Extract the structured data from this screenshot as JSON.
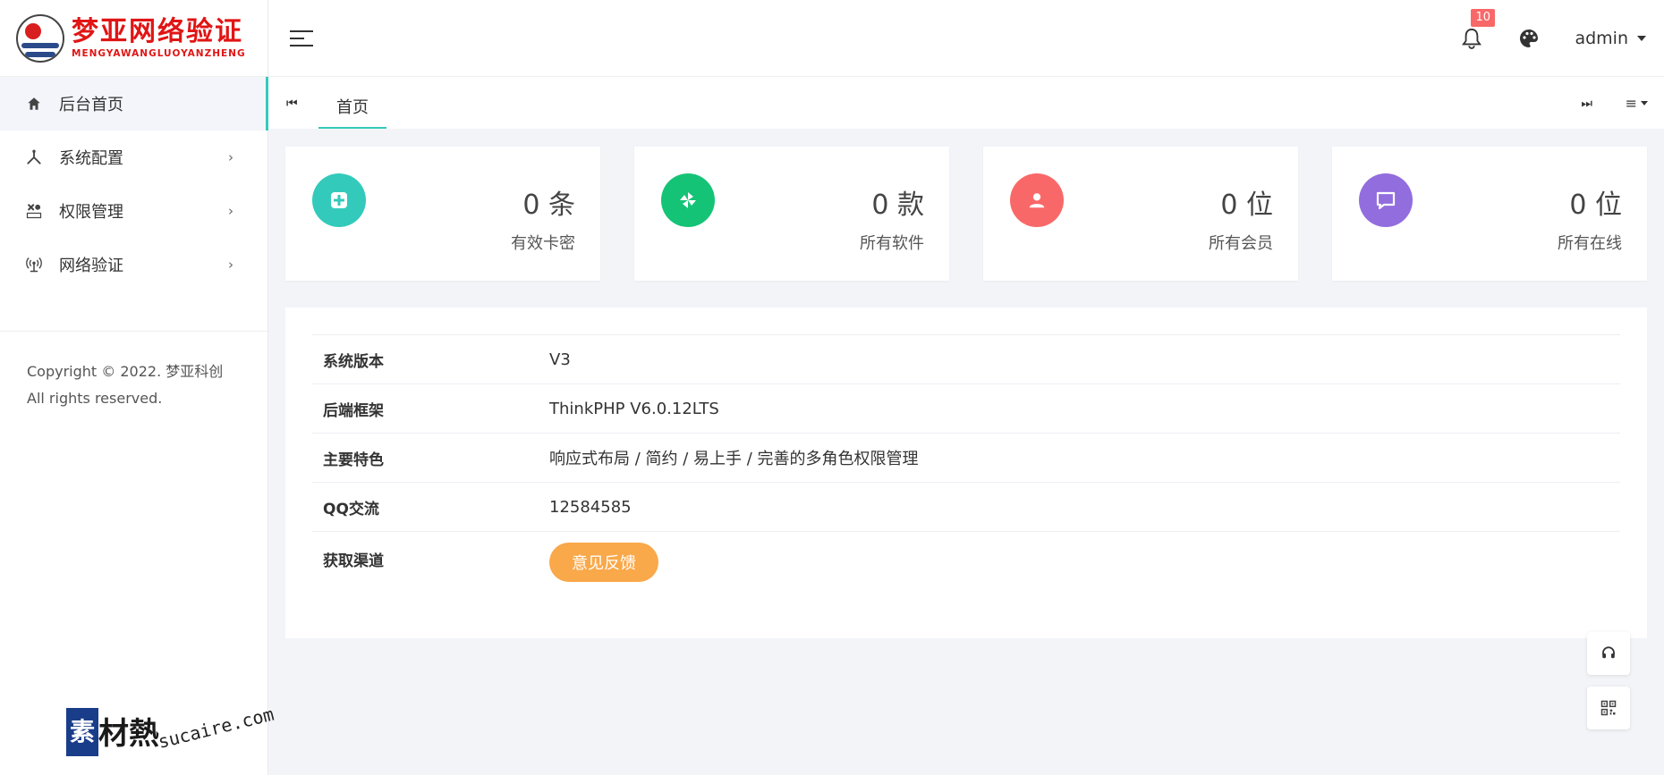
{
  "brand": {
    "title_cn": "梦亚网络验证",
    "title_en": "MENGYAWANGLUOYANZHENG",
    "accent": "#33cabb"
  },
  "sidebar": {
    "items": [
      {
        "label": "后台首页",
        "icon": "home-icon",
        "active": true
      },
      {
        "label": "系统配置",
        "icon": "tools-icon",
        "arrow": "›"
      },
      {
        "label": "权限管理",
        "icon": "permission-icon",
        "arrow": "›"
      },
      {
        "label": "网络验证",
        "icon": "network-icon",
        "arrow": "›"
      }
    ],
    "copyright": "Copyright © 2022. 梦亚科创 All rights reserved."
  },
  "header": {
    "notification_count": "10",
    "user": "admin"
  },
  "tabs": {
    "active": "首页"
  },
  "stats": [
    {
      "value": "0 条",
      "label": "有效卡密",
      "color": "#33cabb"
    },
    {
      "value": "0 款",
      "label": "所有软件",
      "color": "#15c377"
    },
    {
      "value": "0 位",
      "label": "所有会员",
      "color": "#f96868"
    },
    {
      "value": "0 位",
      "label": "所有在线",
      "color": "#926dde"
    }
  ],
  "info": {
    "version_key": "系统版本",
    "version_val": "V3",
    "framework_key": "后端框架",
    "framework_val": "ThinkPHP V6.0.12LTS",
    "feature_key": "主要特色",
    "feature_val": "响应式布局 / 简约 / 易上手 / 完善的多角色权限管理",
    "qq_key": "QQ交流",
    "qq_val": "12584585",
    "channel_key": "获取渠道",
    "feedback_label": "意见反馈"
  },
  "watermark": {
    "box": "素",
    "text": "材熱",
    "domain": "sucaire.com"
  }
}
